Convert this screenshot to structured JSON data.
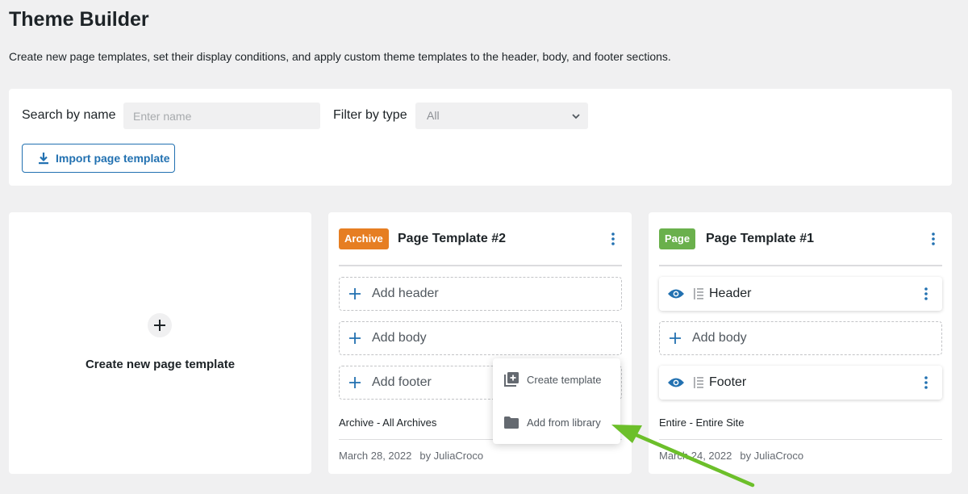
{
  "page": {
    "title": "Theme Builder",
    "description": "Create new page templates, set their display conditions, and apply custom theme templates to the header, body, and footer sections."
  },
  "filters": {
    "search_label": "Search by name",
    "search_placeholder": "Enter name",
    "type_label": "Filter by type",
    "type_value": "All",
    "import_label": "Import page template"
  },
  "create_card": {
    "label": "Create new page template"
  },
  "templates": [
    {
      "badge": "Archive",
      "badge_color": "#e67e22",
      "title": "Page Template #2",
      "slots": [
        "Add header",
        "Add body",
        "Add footer"
      ],
      "condition": "Archive - All Archives",
      "date": "March 28, 2022",
      "author": "by JuliaCroco"
    },
    {
      "badge": "Page",
      "badge_color": "#6ab04c",
      "title": "Page Template #1",
      "header": "Header",
      "add_body": "Add body",
      "footer": "Footer",
      "condition": "Entire - Entire Site",
      "date": "March 24, 2022",
      "author": "by JuliaCroco"
    }
  ],
  "dropdown": {
    "create_template": "Create template",
    "add_from_library": "Add from library"
  },
  "colors": {
    "accent": "#2271b1",
    "annotation_arrow": "#6cbf2a"
  }
}
